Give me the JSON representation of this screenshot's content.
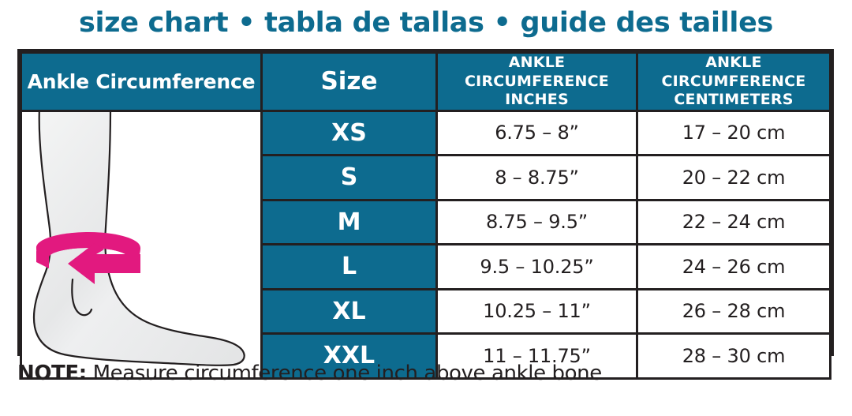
{
  "title": "size chart • tabla de tallas • guide des tailles",
  "colors": {
    "teal": "#0d6b8f",
    "ink": "#231f20",
    "magenta": "#e2197f",
    "leg_fill": "#eceded",
    "white": "#ffffff"
  },
  "table": {
    "illustration_header": "Ankle Circumference",
    "illustration_alt": "leg-and-foot-with-measuring-tape-around-ankle",
    "headers": {
      "size": "Size",
      "inches": [
        "ANKLE",
        "CIRCUMFERENCE",
        "INCHES"
      ],
      "centimeters": [
        "ANKLE",
        "CIRCUMFERENCE",
        "CENTIMETERS"
      ]
    },
    "rows": [
      {
        "size": "XS",
        "inches": "6.75 – 8”",
        "centimeters": "17 – 20 cm"
      },
      {
        "size": "S",
        "inches": "8 – 8.75”",
        "centimeters": "20 – 22 cm"
      },
      {
        "size": "M",
        "inches": "8.75 – 9.5”",
        "centimeters": "22 – 24 cm"
      },
      {
        "size": "L",
        "inches": "9.5 – 10.25”",
        "centimeters": "24 – 26 cm"
      },
      {
        "size": "XL",
        "inches": "10.25 – 11”",
        "centimeters": "26 – 28 cm"
      },
      {
        "size": "XXL",
        "inches": "11 – 11.75”",
        "centimeters": "28 – 30 cm"
      }
    ]
  },
  "note": {
    "label": "NOTE:",
    "text": " Measure circumference one inch above ankle bone"
  }
}
